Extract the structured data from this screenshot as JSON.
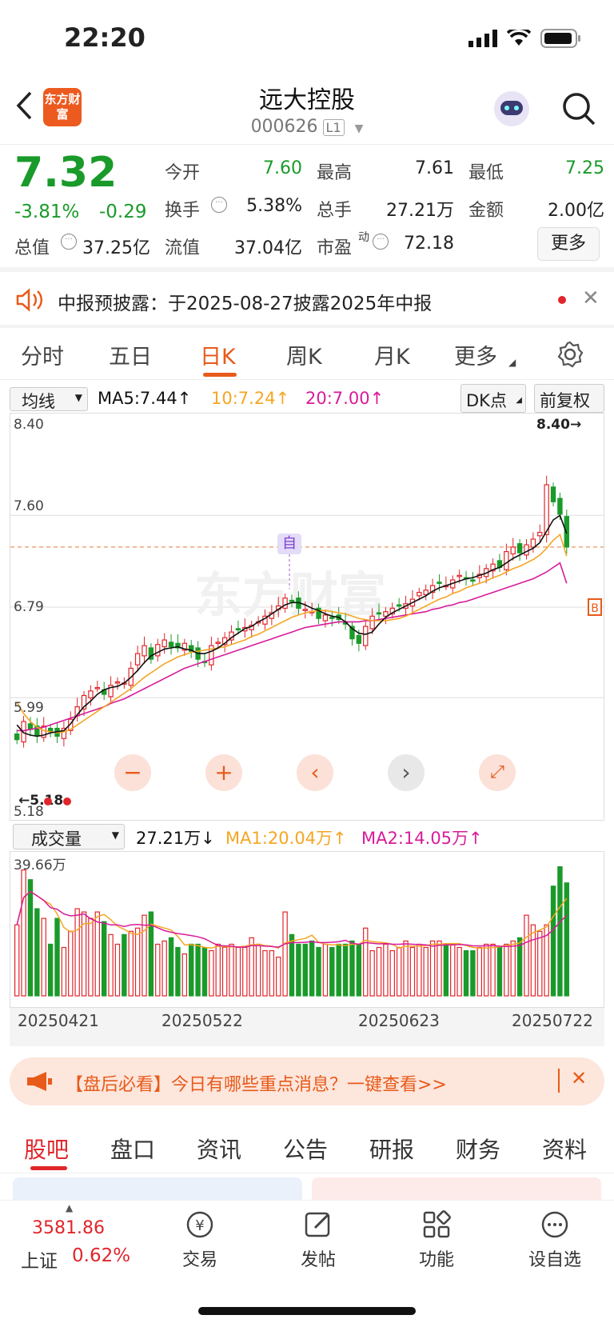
{
  "status": {
    "time": "22:20"
  },
  "header": {
    "logo_text": "东方财富",
    "title": "远大控股",
    "code": "000626",
    "level_badge": "L1"
  },
  "quote": {
    "price": "7.32",
    "change_pct": "-3.81%",
    "change": "-0.29",
    "fields": [
      {
        "label": "今开",
        "value": "7.60",
        "color": "green"
      },
      {
        "label": "最高",
        "value": "7.61",
        "color": "black"
      },
      {
        "label": "最低",
        "value": "7.25",
        "color": "green"
      },
      {
        "label": "换手",
        "value": "5.38%",
        "color": "black"
      },
      {
        "label": "总手",
        "value": "27.21万",
        "color": "black"
      },
      {
        "label": "金额",
        "value": "2.00亿",
        "color": "black"
      },
      {
        "label": "总值",
        "value": "37.25亿",
        "color": "black"
      },
      {
        "label": "流值",
        "value": "37.04亿",
        "color": "black"
      },
      {
        "label": "市盈",
        "value": "72.18",
        "color": "black"
      }
    ],
    "pe_superscript": "动",
    "more": "更多"
  },
  "notice": {
    "text": "中报预披露：于2025-08-27披露2025年中报"
  },
  "tabs": [
    "分时",
    "五日",
    "日K",
    "周K",
    "月K",
    "更多"
  ],
  "active_tab": "日K",
  "ma": {
    "selector": "均线",
    "ma5": "MA5:7.44",
    "ma10": "10:7.24",
    "ma20": "20:7.00",
    "dk": "DK点",
    "adjust": "前复权"
  },
  "chart_axis": {
    "y_top": "8.40",
    "y2": "7.60",
    "y3": "6.79",
    "y4": "5.99",
    "y_bottom": "5.18",
    "max_label": "8.40",
    "min_label": "5.18",
    "self_tag": "自",
    "end_tag": "B"
  },
  "volume": {
    "selector": "成交量",
    "value": "27.21万",
    "ma1": "MA1:20.04万",
    "ma2": "MA2:14.05万",
    "top_label": "39.66万"
  },
  "dates": [
    "20250421",
    "20250522",
    "20250623",
    "20250722"
  ],
  "banner": {
    "text": "【盘后必看】今日有哪些重点消息？一键查看>>"
  },
  "bottom_tabs": [
    "股吧",
    "盘口",
    "资讯",
    "公告",
    "研报",
    "财务",
    "资料"
  ],
  "footer": {
    "index_value": "3581.86",
    "index_name": "上证",
    "index_change": "0.62%",
    "items": [
      "交易",
      "发帖",
      "功能",
      "设自选"
    ]
  },
  "chart_data": {
    "type": "candlestick",
    "ylim": [
      5.18,
      8.4
    ],
    "close": [
      5.62,
      5.78,
      5.71,
      5.66,
      5.74,
      5.69,
      5.65,
      5.72,
      5.8,
      5.91,
      6.01,
      6.05,
      6.08,
      6.02,
      6.1,
      6.13,
      6.12,
      6.25,
      6.38,
      6.45,
      6.33,
      6.46,
      6.5,
      6.44,
      6.43,
      6.47,
      6.4,
      6.33,
      6.3,
      6.45,
      6.48,
      6.52,
      6.57,
      6.6,
      6.61,
      6.63,
      6.66,
      6.71,
      6.74,
      6.8,
      6.87,
      6.84,
      6.78,
      6.77,
      6.75,
      6.69,
      6.72,
      6.69,
      6.68,
      6.64,
      6.51,
      6.47,
      6.62,
      6.71,
      6.73,
      6.75,
      6.78,
      6.8,
      6.82,
      6.86,
      6.92,
      6.94,
      6.98,
      7.0,
      6.98,
      7.03,
      7.07,
      7.05,
      7.02,
      7.08,
      7.13,
      7.17,
      7.14,
      7.28,
      7.32,
      7.27,
      7.34,
      7.39,
      7.45,
      7.87,
      7.72,
      7.61,
      7.32
    ],
    "ma5": [
      5.75,
      5.68,
      5.66,
      5.65,
      5.66,
      5.68,
      5.69,
      5.7,
      5.76,
      5.84,
      5.91,
      5.96,
      6.02,
      6.06,
      6.08,
      6.09,
      6.12,
      6.17,
      6.23,
      6.3,
      6.36,
      6.39,
      6.42,
      6.43,
      6.44,
      6.42,
      6.41,
      6.38,
      6.38,
      6.4,
      6.43,
      6.47,
      6.52,
      6.56,
      6.6,
      6.62,
      6.66,
      6.69,
      6.73,
      6.77,
      6.81,
      6.83,
      6.83,
      6.81,
      6.78,
      6.76,
      6.73,
      6.71,
      6.7,
      6.66,
      6.6,
      6.56,
      6.55,
      6.57,
      6.64,
      6.7,
      6.74,
      6.77,
      6.8,
      6.83,
      6.86,
      6.89,
      6.93,
      6.96,
      6.98,
      7.0,
      7.02,
      7.04,
      7.05,
      7.07,
      7.09,
      7.12,
      7.14,
      7.18,
      7.22,
      7.25,
      7.28,
      7.31,
      7.36,
      7.46,
      7.56,
      7.6,
      7.44
    ],
    "ma10": [
      5.95,
      5.85,
      5.78,
      5.73,
      5.7,
      5.69,
      5.68,
      5.69,
      5.71,
      5.75,
      5.79,
      5.83,
      5.87,
      5.91,
      5.95,
      5.99,
      6.03,
      6.07,
      6.12,
      6.17,
      6.21,
      6.25,
      6.29,
      6.32,
      6.35,
      6.37,
      6.39,
      6.4,
      6.41,
      6.42,
      6.43,
      6.44,
      6.46,
      6.48,
      6.5,
      6.53,
      6.55,
      6.58,
      6.61,
      6.64,
      6.67,
      6.7,
      6.72,
      6.74,
      6.75,
      6.76,
      6.76,
      6.75,
      6.74,
      6.73,
      6.71,
      6.69,
      6.68,
      6.67,
      6.67,
      6.67,
      6.68,
      6.69,
      6.71,
      6.74,
      6.77,
      6.8,
      6.83,
      6.86,
      6.88,
      6.91,
      6.93,
      6.96,
      6.98,
      7.0,
      7.02,
      7.05,
      7.07,
      7.1,
      7.13,
      7.15,
      7.18,
      7.21,
      7.25,
      7.31,
      7.38,
      7.43,
      7.24
    ],
    "ma20": [
      5.7,
      5.7,
      5.71,
      5.72,
      5.73,
      5.75,
      5.77,
      5.79,
      5.81,
      5.83,
      5.85,
      5.87,
      5.89,
      5.91,
      5.94,
      5.96,
      5.98,
      6.01,
      6.04,
      6.07,
      6.1,
      6.13,
      6.16,
      6.19,
      6.22,
      6.25,
      6.27,
      6.29,
      6.31,
      6.33,
      6.35,
      6.37,
      6.39,
      6.41,
      6.43,
      6.45,
      6.47,
      6.49,
      6.51,
      6.53,
      6.55,
      6.57,
      6.59,
      6.61,
      6.62,
      6.63,
      6.64,
      6.65,
      6.66,
      6.66,
      6.66,
      6.66,
      6.67,
      6.67,
      6.68,
      6.69,
      6.7,
      6.71,
      6.72,
      6.73,
      6.74,
      6.75,
      6.77,
      6.78,
      6.8,
      6.81,
      6.83,
      6.84,
      6.86,
      6.88,
      6.9,
      6.92,
      6.94,
      6.96,
      6.98,
      7.0,
      7.02,
      7.04,
      7.07,
      7.1,
      7.14,
      7.18,
      7.0
    ],
    "volume_ylim": [
      0,
      39.66
    ],
    "volume": [
      22,
      39,
      36,
      27,
      24,
      16,
      24,
      15,
      20,
      27,
      26,
      24,
      26,
      23,
      19,
      16,
      19,
      20,
      21,
      25,
      26,
      16,
      17,
      18,
      15,
      13,
      16,
      16,
      15,
      14,
      16,
      15,
      16,
      15,
      15,
      18,
      16,
      14,
      14,
      12,
      26,
      19,
      16,
      16,
      17,
      15,
      16,
      15,
      16,
      16,
      17,
      16,
      21,
      14,
      15,
      16,
      14,
      15,
      17,
      15,
      16,
      15,
      17,
      17,
      16,
      16,
      15,
      14,
      14,
      15,
      16,
      16,
      15,
      16,
      17,
      18,
      25,
      22,
      20,
      22,
      34,
      40,
      35
    ]
  }
}
